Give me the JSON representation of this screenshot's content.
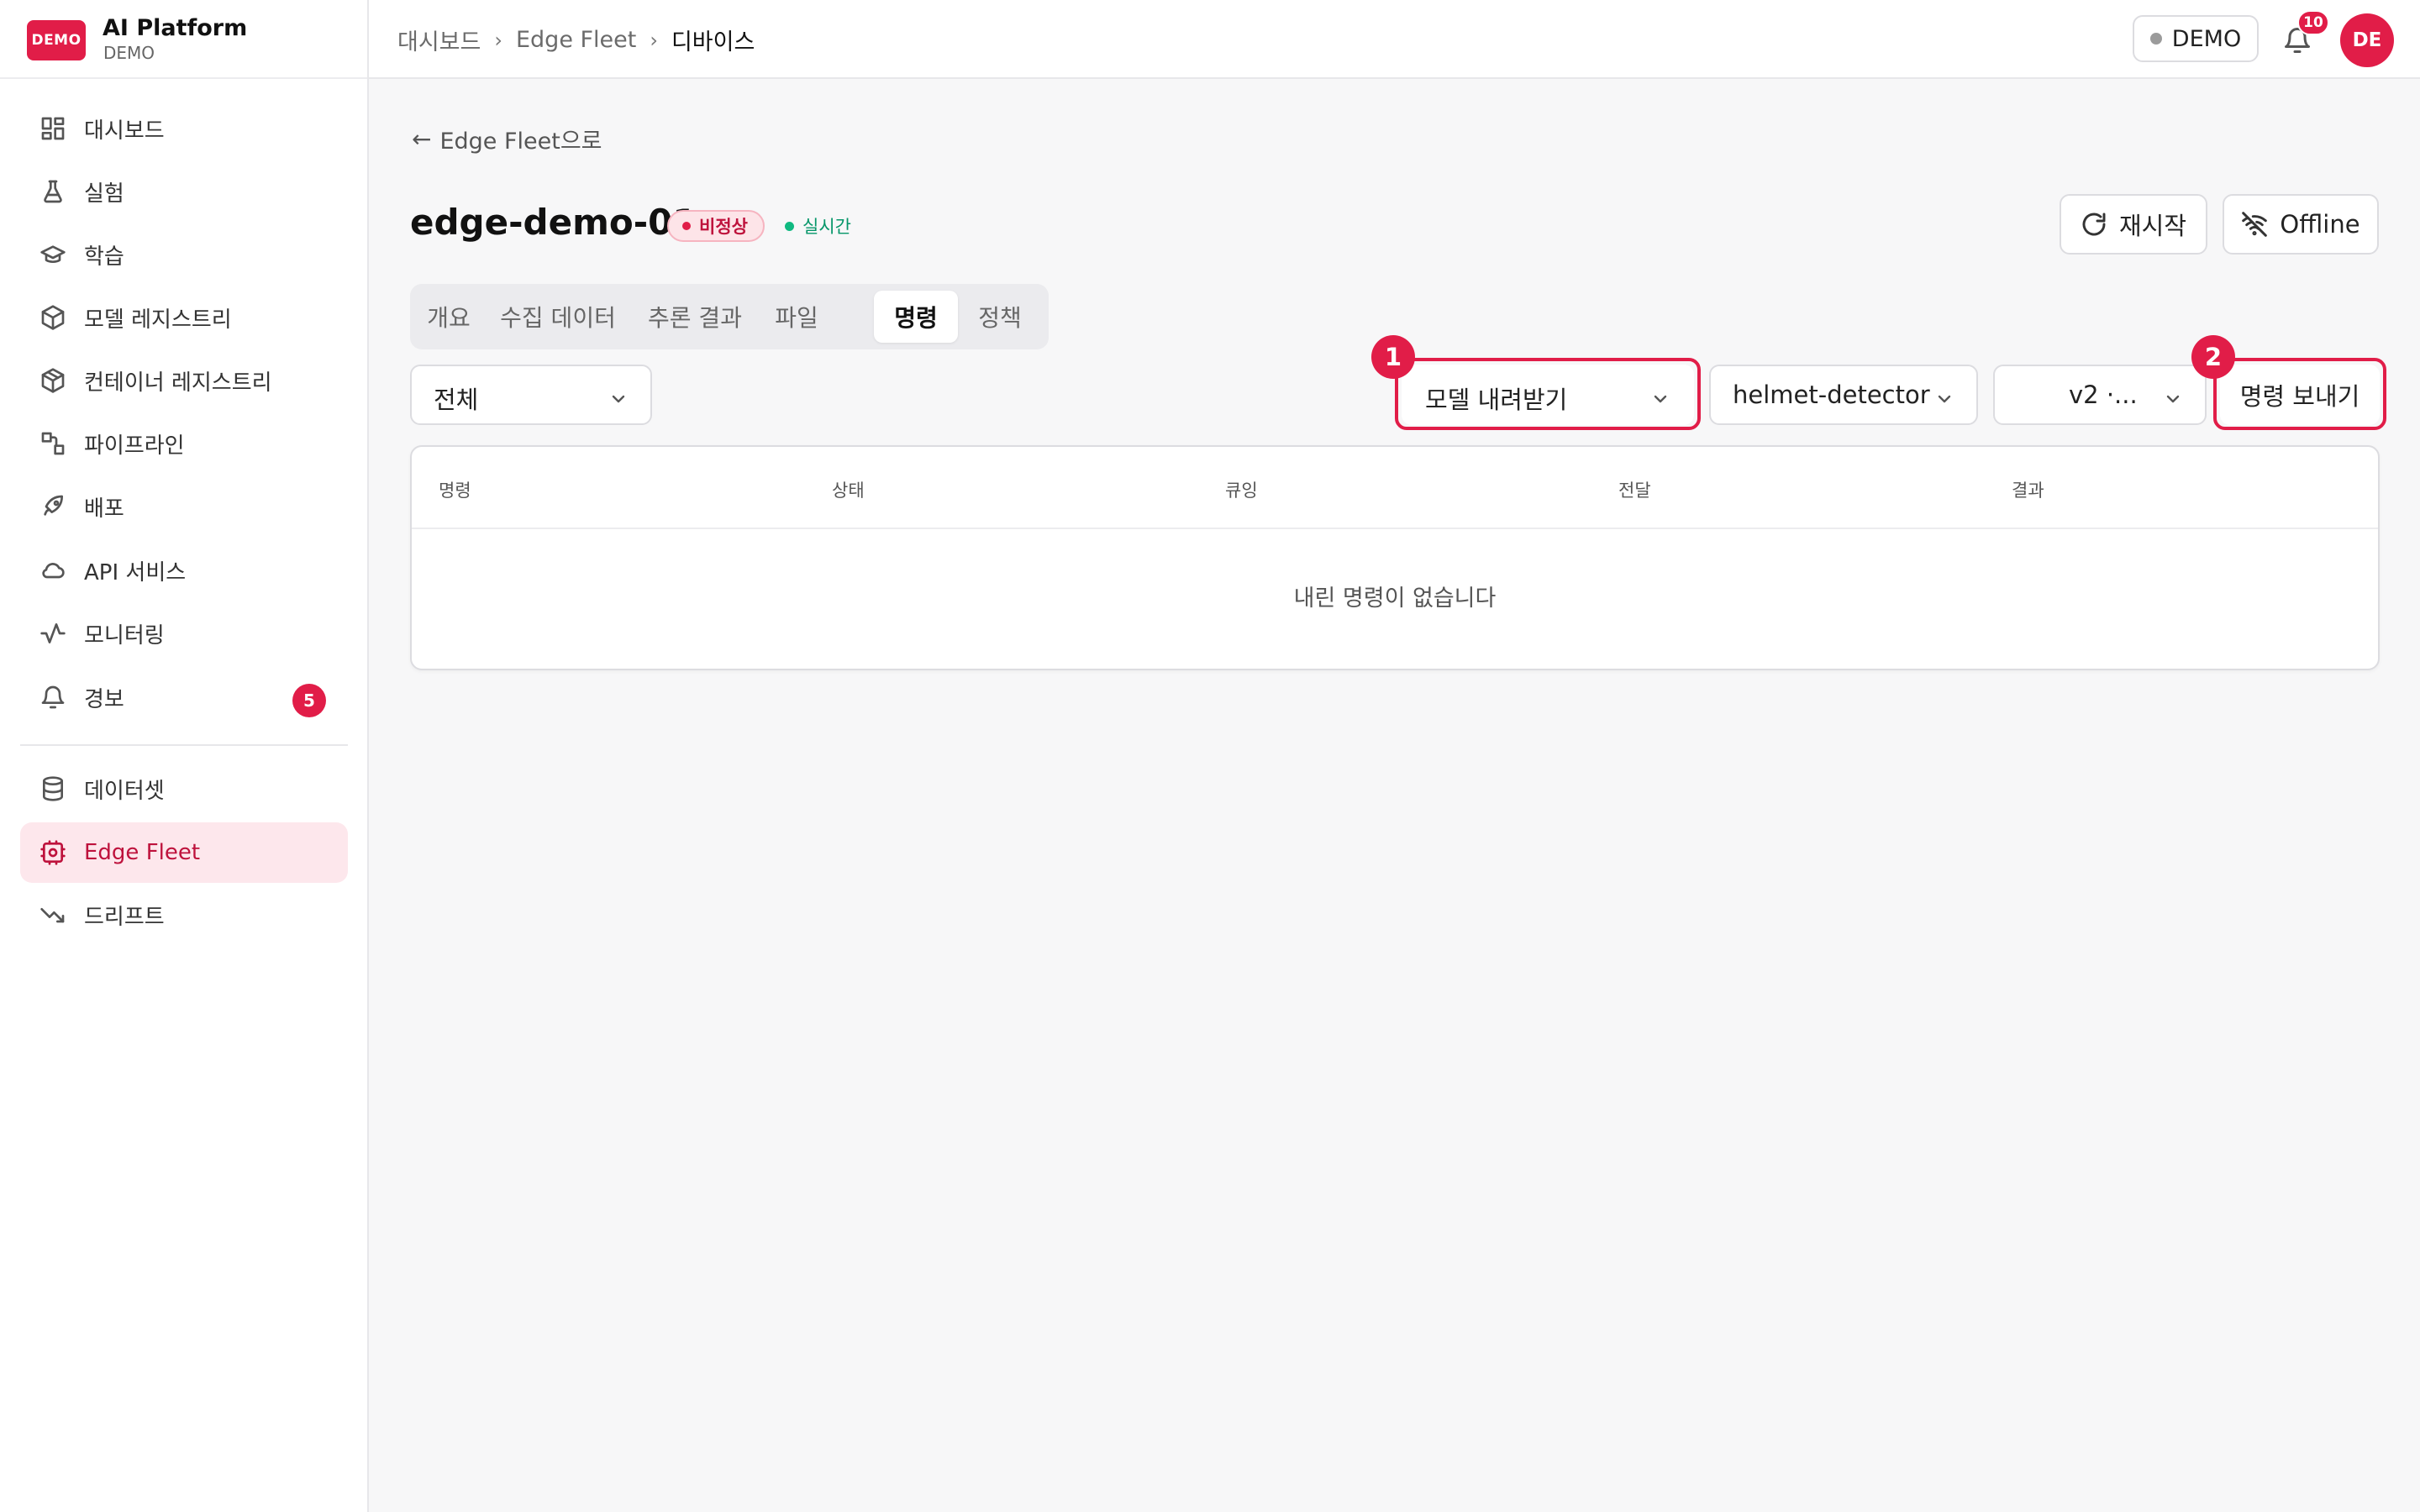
{
  "brand": {
    "logo_text": "DEMO",
    "name": "AI Platform",
    "subtitle": "DEMO"
  },
  "sidebar": {
    "items": [
      {
        "label": "대시보드",
        "icon": "dashboard-icon"
      },
      {
        "label": "실험",
        "icon": "flask-icon"
      },
      {
        "label": "학습",
        "icon": "graduation-cap-icon"
      },
      {
        "label": "모델 레지스트리",
        "icon": "cube-icon"
      },
      {
        "label": "컨테이너 레지스트리",
        "icon": "container-icon"
      },
      {
        "label": "파이프라인",
        "icon": "pipeline-icon"
      },
      {
        "label": "배포",
        "icon": "rocket-icon"
      },
      {
        "label": "API 서비스",
        "icon": "cloud-icon"
      },
      {
        "label": "모니터링",
        "icon": "activity-icon"
      },
      {
        "label": "경보",
        "icon": "bell-icon",
        "badge": "5"
      },
      {
        "label": "데이터셋",
        "icon": "database-icon"
      },
      {
        "label": "Edge Fleet",
        "icon": "edge-device-icon",
        "active": true
      },
      {
        "label": "드리프트",
        "icon": "trending-down-icon"
      }
    ]
  },
  "topbar": {
    "breadcrumbs": [
      "대시보드",
      "Edge Fleet",
      "디바이스"
    ],
    "env_label": "DEMO",
    "notification_count": "10",
    "avatar_initials": "DE"
  },
  "device": {
    "back_label": "Edge Fleet으로",
    "name": "edge-demo-01",
    "status": "비정상",
    "live_label": "실시간",
    "restart_label": "재시작",
    "offline_label": "Offline"
  },
  "tabs": [
    {
      "label": "개요"
    },
    {
      "label": "수집 데이터"
    },
    {
      "label": "추론 결과"
    },
    {
      "label": "파일"
    },
    {
      "label": "명령",
      "active": true
    },
    {
      "label": "정책"
    }
  ],
  "controls": {
    "filter_value": "전체",
    "command_type_value": "모델 내려받기",
    "model_value": "helmet-detector",
    "version_value": "v2 ·...",
    "send_label": "명령 보내기",
    "markers": [
      "1",
      "2"
    ]
  },
  "table": {
    "columns": [
      "명령",
      "상태",
      "큐잉",
      "전달",
      "결과"
    ],
    "rows": [],
    "empty_message": "내린 명령이 없습니다"
  },
  "colors": {
    "accent": "#e11d48",
    "success": "#10b981"
  }
}
